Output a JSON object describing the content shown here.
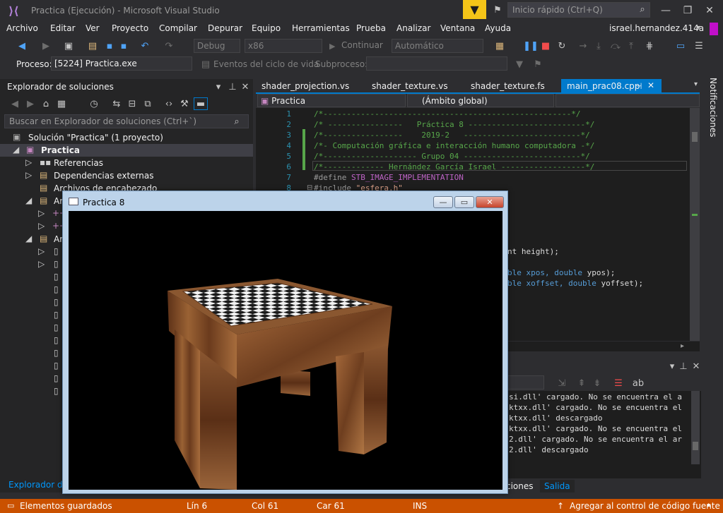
{
  "window": {
    "title": "Practica (Ejecución) - Microsoft Visual Studio"
  },
  "quick_launch": {
    "placeholder": "Inicio rápido (Ctrl+Q)"
  },
  "menu": [
    "Archivo",
    "Editar",
    "Ver",
    "Proyecto",
    "Compilar",
    "Depurar",
    "Equipo",
    "Herramientas",
    "Prueba",
    "Analizar",
    "Ventana",
    "Ayuda"
  ],
  "user": {
    "name": "israel.hernandez.414a"
  },
  "toolbar": {
    "config": "Debug",
    "platform": "x86",
    "continue_label": "Continuar",
    "auto": "Automático"
  },
  "process_row": {
    "label": "Proceso:",
    "value": "[5224] Practica.exe",
    "events_label": "Eventos del ciclo de vida",
    "thread_label": "Subproceso:"
  },
  "solution_explorer": {
    "title": "Explorador de soluciones",
    "search_placeholder": "Buscar en Explorador de soluciones (Ctrl+`)",
    "solution": "Solución \"Practica\"  (1 proyecto)",
    "project": "Practica",
    "nodes": [
      "Referencias",
      "Dependencias externas",
      "Archivos de encabezado",
      "Ar",
      "Ar"
    ],
    "footer": "Explorador de"
  },
  "editor": {
    "tabs": [
      "shader_projection.vs",
      "shader_texture.vs",
      "shader_texture.fs",
      "main_prac08.cpp"
    ],
    "nav_project": "Practica",
    "nav_scope": "(Ámbito global)",
    "line_numbers": [
      "1",
      "2",
      "3",
      "4",
      "5",
      "6",
      "7",
      "8"
    ],
    "lines": [
      "/*-----------------------------------------------------*/",
      "/* ----------------   Práctica 8 -------------------------*/",
      "/*-----------------    2019-2   -------------------------*/",
      "/*- Computación gráfica e interacción humano computadora -*/",
      "/*-------------------- Grupo 04 -------------------------*/",
      "/*------------- Hernández García Israel ------------------*/",
      "STB_IMAGE_IMPLEMENTATION",
      "\"esfera.h\""
    ],
    "define_kw": "#define",
    "include_kw": "#include",
    "frag_a": "nt height);",
    "frag_b1": "ble xpos, ",
    "frag_b2": "double",
    "frag_b3": " ypos);",
    "frag_c1": "ble xoffset, ",
    "frag_c2": "double",
    "frag_c3": " yoffset);"
  },
  "notifications": "Notificaciones",
  "output": {
    "lines": [
      "si.dll' cargado. No se encuentra el a",
      "ktxx.dll' cargado. No se encuentra el",
      "ktxx.dll' descargado",
      "ktxx.dll' cargado. No se encuentra el",
      "2.dll' cargado. No se encuentra el ar",
      "2.dll' descargado"
    ],
    "tab_a": "ciones",
    "tab_b": "Salida"
  },
  "status": {
    "saved": "Elementos guardados",
    "line": "Lín 6",
    "col": "Col 61",
    "char": "Car 61",
    "ins": "INS",
    "scm": "Agregar al control de código fuente"
  },
  "app_window": {
    "title": "Practica 8"
  },
  "colors": {
    "accent": "#007acc",
    "status": "#ca5100",
    "filter": "#f5c518"
  }
}
